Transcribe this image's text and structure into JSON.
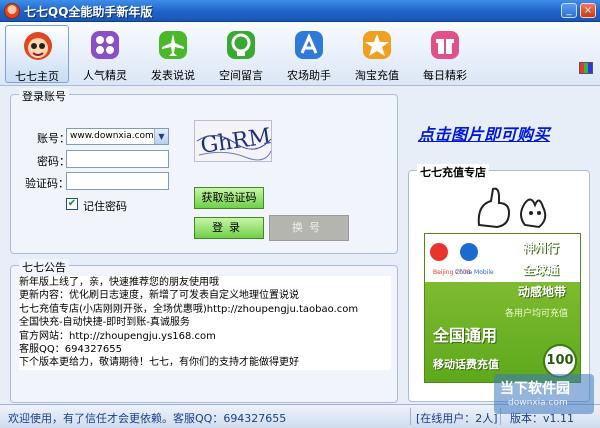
{
  "window": {
    "title": "七七QQ全能助手新年版",
    "min_glyph": "_",
    "close_glyph": "×"
  },
  "toolbar": {
    "items": [
      {
        "label": "七七主页",
        "icon": "qiqi-avatar-icon",
        "color": "#e0461f"
      },
      {
        "label": "人气精灵",
        "icon": "dice-icon",
        "color": "#8a4fc4"
      },
      {
        "label": "发表说说",
        "icon": "airplane-icon",
        "color": "#4bb82a"
      },
      {
        "label": "空间留言",
        "icon": "chat-bubble-icon",
        "color": "#3aa832"
      },
      {
        "label": "农场助手",
        "icon": "app-store-icon",
        "color": "#2f7ad8"
      },
      {
        "label": "淘宝充值",
        "icon": "star-icon",
        "color": "#f0a020"
      },
      {
        "label": "每日精彩",
        "icon": "gift-icon",
        "color": "#e0508a"
      }
    ]
  },
  "login": {
    "group_title": "登录账号",
    "account_label": "账号：",
    "account_value": "www.downxia.com",
    "password_label": "密码：",
    "captcha_label": "验证码：",
    "captcha_text": "GhRM",
    "remember_label": "记住密码",
    "remember_checked": true,
    "get_code_button": "获取验证码",
    "login_button": "登录",
    "switch_button": "换号"
  },
  "notice": {
    "group_title": "七七公告",
    "lines": [
      "新年版上线了，亲，快速推荐您的朋友使用哦",
      "更新内容：优化刷日志速度，新增了可发表自定义地理位置说说",
      "七七充值专店(小店刚刚开张，全场优惠哦)http://zhoupengju.taobao.com",
      "全国快充-自动快捷-即时到账-真诚服务",
      "官方网站：http://zhoupengju.ys168.com",
      "客服QQ：694327655",
      "下个版本更给力，敬请期待！七七，有你们的支持才能做得更好"
    ]
  },
  "promo": {
    "link_text": "点击图片即可购买"
  },
  "shop": {
    "group_title": "七七充值专店",
    "card": {
      "line1": "神州行",
      "line2": "全球通",
      "line3": "动感地带",
      "line4": "各用户均可充值",
      "line5": "全国通用",
      "line6": "移动话费充值",
      "amount": "100"
    }
  },
  "status": {
    "welcome": "欢迎使用，有了信任才会更依赖。客服QQ：694327655",
    "online": "[在线用户：2人]",
    "version": "版本：v1.11"
  },
  "watermark": {
    "text": "当下软件园",
    "sub": "downxia.com"
  }
}
